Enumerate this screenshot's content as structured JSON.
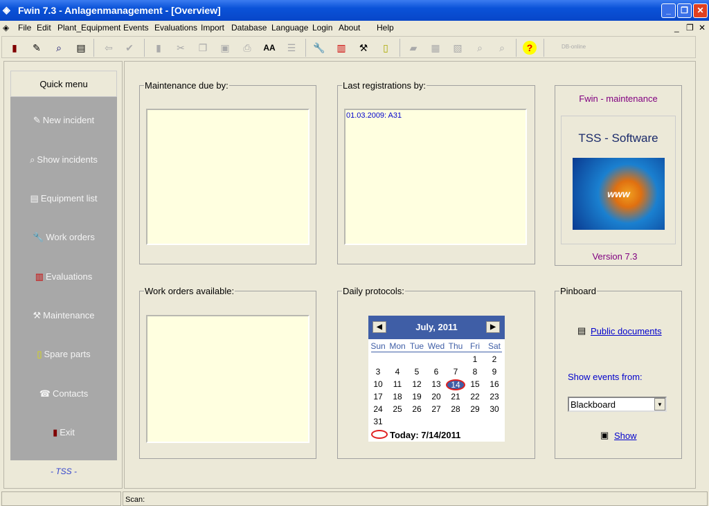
{
  "window": {
    "title": "Fwin 7.3 - Anlagenmanagement - [Overview]"
  },
  "menu": [
    "File",
    "Edit",
    "Plant_Equipment",
    "Events",
    "Evaluations",
    "Import",
    "Database",
    "Language",
    "Login",
    "About",
    "Help"
  ],
  "toolbar": {
    "status": "DB-online"
  },
  "quick_menu": {
    "title": "Quick menu",
    "items": [
      "New incident",
      "Show incidents",
      "Equipment list",
      "Work orders",
      "Evaluations",
      "Maintenance",
      "Spare parts",
      "Contacts",
      "Exit"
    ],
    "footer": "- TSS -"
  },
  "maintenance": {
    "label": "Maintenance due by:"
  },
  "registrations": {
    "label": "Last registrations by:",
    "items": [
      "01.03.2009: A31"
    ]
  },
  "info": {
    "title": "Fwin - maintenance",
    "company": "TSS - Software",
    "version": "Version 7.3",
    "logo_text": "www"
  },
  "work_orders": {
    "label": "Work orders available:"
  },
  "daily": {
    "label": "Daily protocols:"
  },
  "calendar": {
    "month": "July, 2011",
    "days": [
      "Sun",
      "Mon",
      "Tue",
      "Wed",
      "Thu",
      "Fri",
      "Sat"
    ],
    "first_weekday": 5,
    "days_in_month": 31,
    "selected": 14,
    "today": "Today: 7/14/2011"
  },
  "pinboard": {
    "label": "Pinboard",
    "public_docs": "Public documents",
    "events_label": "Show events from:",
    "events_value": "Blackboard",
    "show": "Show"
  },
  "status": {
    "scan": "Scan:"
  },
  "colors": {
    "accent": "#3f5ea6",
    "list_bg": "#ffffe0",
    "quick_menu_bg": "#a8a8a8",
    "purple": "#800080"
  }
}
